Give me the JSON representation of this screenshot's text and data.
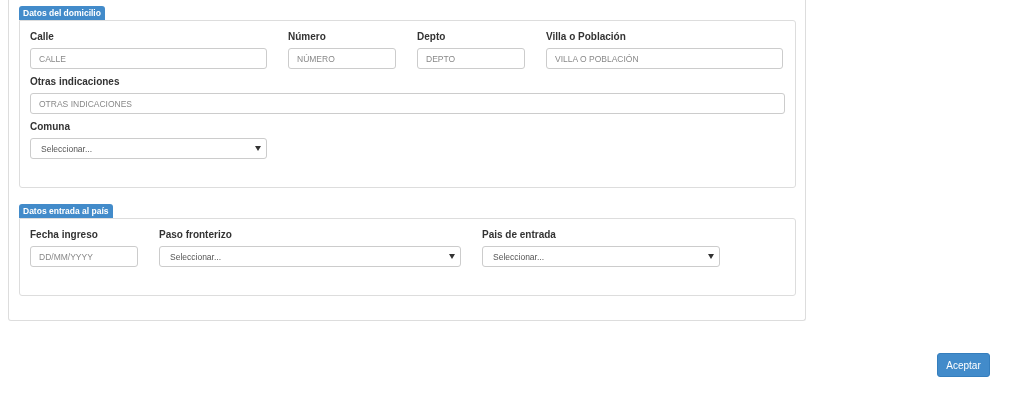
{
  "sections": [
    {
      "legend": "Datos del domicilio",
      "rows": [
        [
          {
            "label": "Calle",
            "kind": "text",
            "placeholder": "CALLE"
          },
          {
            "label": "Número",
            "kind": "text",
            "placeholder": "NÚMERO"
          },
          {
            "label": "Depto",
            "kind": "text",
            "placeholder": "DEPTO"
          },
          {
            "label": "Villa o Población",
            "kind": "text",
            "placeholder": "VILLA O POBLACIÓN"
          }
        ],
        [
          {
            "label": "Otras indicaciones",
            "kind": "text",
            "placeholder": "OTRAS INDICACIONES"
          }
        ],
        [
          {
            "label": "Comuna",
            "kind": "select",
            "value": "Seleccionar..."
          }
        ]
      ]
    },
    {
      "legend": "Datos entrada al país",
      "rows": [
        [
          {
            "label": "Fecha ingreso",
            "kind": "text",
            "placeholder": "DD/MM/YYYY"
          },
          {
            "label": "Paso fronterizo",
            "kind": "select",
            "value": "Seleccionar..."
          },
          {
            "label": "Pais de entrada",
            "kind": "select",
            "value": "Seleccionar..."
          }
        ]
      ]
    }
  ],
  "buttons": [
    {
      "label": "Aceptar"
    }
  ]
}
